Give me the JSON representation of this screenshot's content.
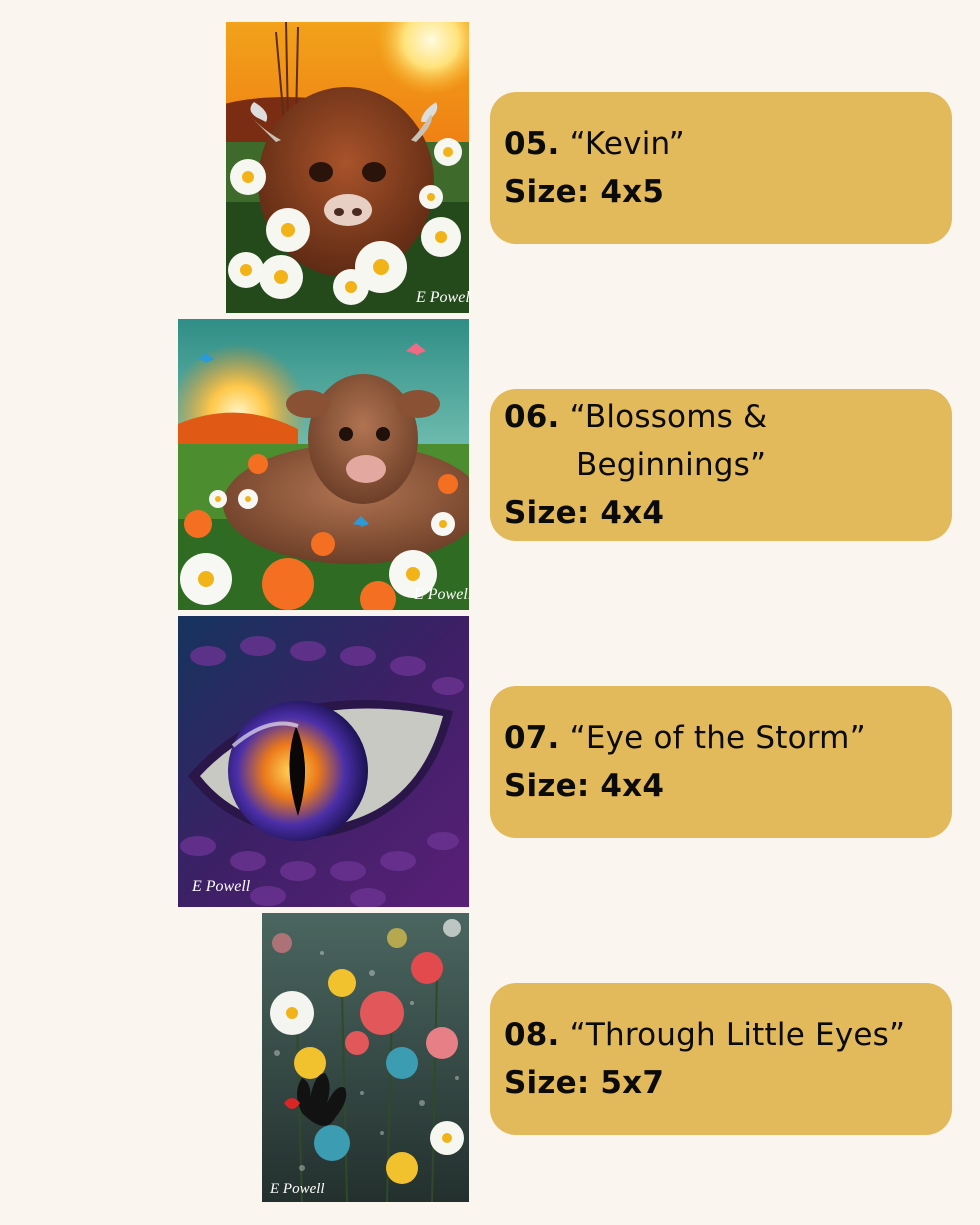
{
  "items": [
    {
      "number": "05.",
      "title_line1": "“Kevin”",
      "title_line2": "",
      "size": "Size: 4x5",
      "image": {
        "subject": "highland-cow-calf-daisies-sunset",
        "signature": "E Powell"
      }
    },
    {
      "number": "06.",
      "title_line1": "“Blossoms &",
      "title_line2": "Beginnings”",
      "size": "Size: 4x4",
      "image": {
        "subject": "calf-lying-in-flower-meadow",
        "signature": "E Powell"
      }
    },
    {
      "number": "07.",
      "title_line1": "“Eye of the Storm”",
      "title_line2": "",
      "size": "Size: 4x4",
      "image": {
        "subject": "purple-dragon-eye",
        "signature": "E Powell"
      }
    },
    {
      "number": "08.",
      "title_line1": "“Through Little Eyes”",
      "title_line2": "",
      "size": "Size: 5x7",
      "image": {
        "subject": "flowers-behind-rainy-glass-handprint",
        "signature": "E Powell"
      }
    }
  ],
  "colors": {
    "background": "#faf5ef",
    "card": "#e2b95b",
    "text": "#0b0b0b"
  }
}
